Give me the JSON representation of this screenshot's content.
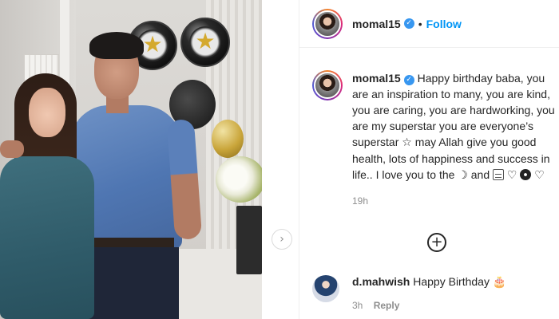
{
  "post": {
    "username": "momal15",
    "follow_label": "Follow",
    "separator": "•",
    "verified_icon": "verified-badge-icon"
  },
  "caption": {
    "username": "momal15",
    "text_part1": "Happy birthday baba, you are an inspiration to many, you are kind, you are caring, you are hardworking, you are my superstar you are everyone’s superstar",
    "text_part2": "may Allah give you good health, lots of happiness and success in life.. I love you to the",
    "text_and": "and",
    "emojis": {
      "star": "☆",
      "moon": "☽",
      "heart": "♡"
    },
    "time": "19h"
  },
  "comment": {
    "username": "d.mahwish",
    "text": "Happy Birthday",
    "time": "3h",
    "reply_label": "Reply",
    "cake_icon": "cake-icon"
  },
  "controls": {
    "next_arrow": "›",
    "add_comment": "+"
  },
  "colors": {
    "link_blue": "#0095f6",
    "verified_blue": "#3897f0",
    "muted_text": "#8e8e8e"
  }
}
